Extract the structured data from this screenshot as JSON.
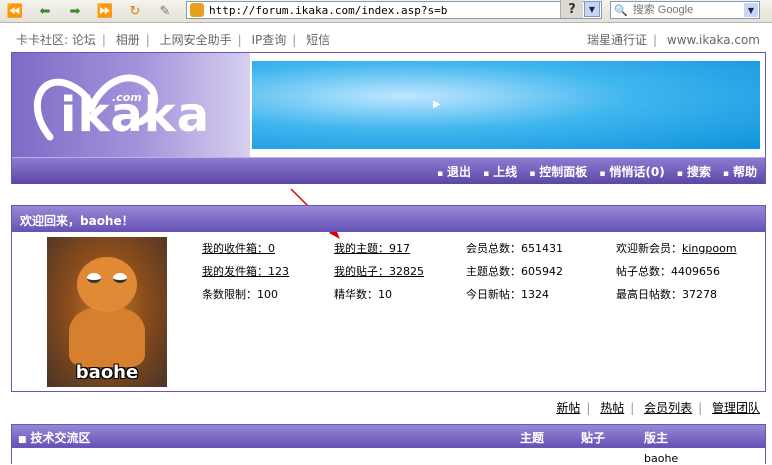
{
  "browser": {
    "url": "http://forum.ikaka.com/index.asp?s=b",
    "help_label": "?",
    "search_placeholder": "搜索 Google"
  },
  "top_links": {
    "left": [
      "卡卡社区: 论坛",
      "相册",
      "上网安全助手",
      "IP查询",
      "短信"
    ],
    "right": [
      "瑞星通行证",
      "www.ikaka.com"
    ]
  },
  "banner": {
    "logo_text": "ikaka",
    "logo_com": ".com",
    "nav": [
      "退出",
      "上线",
      "控制面板",
      "悄悄话(0)",
      "搜索",
      "帮助"
    ]
  },
  "welcome": {
    "title": "欢迎回来，baohe！",
    "avatar_name": "baohe",
    "stats": {
      "inbox_label": "我的收件箱：0",
      "outbox_label": "我的发件箱：123",
      "limit": "条数限制：100",
      "my_topics": "我的主题：917",
      "my_posts": "我的贴子：32825",
      "elite": "精华数：10",
      "members": "会员总数：651431",
      "topics_total": "主题总数：605942",
      "today_posts": "今日新帖：1324",
      "new_member_label": "欢迎新会员：",
      "new_member_name": "kingpoom",
      "posts_total": "帖子总数：4409656",
      "max_day_posts": "最高日帖数：37278"
    }
  },
  "bottom_links": [
    "新帖",
    "热帖",
    "会员列表",
    "管理团队"
  ],
  "forum": {
    "section_title": "技术交流区",
    "col_topics": "主题",
    "col_posts": "贴子",
    "col_moderator": "版主",
    "row_moderator": "baohe"
  },
  "colors": {
    "purple_header": "#6652b5",
    "ad_blue": "#0e92dc",
    "arrow_red": "#e00000"
  }
}
